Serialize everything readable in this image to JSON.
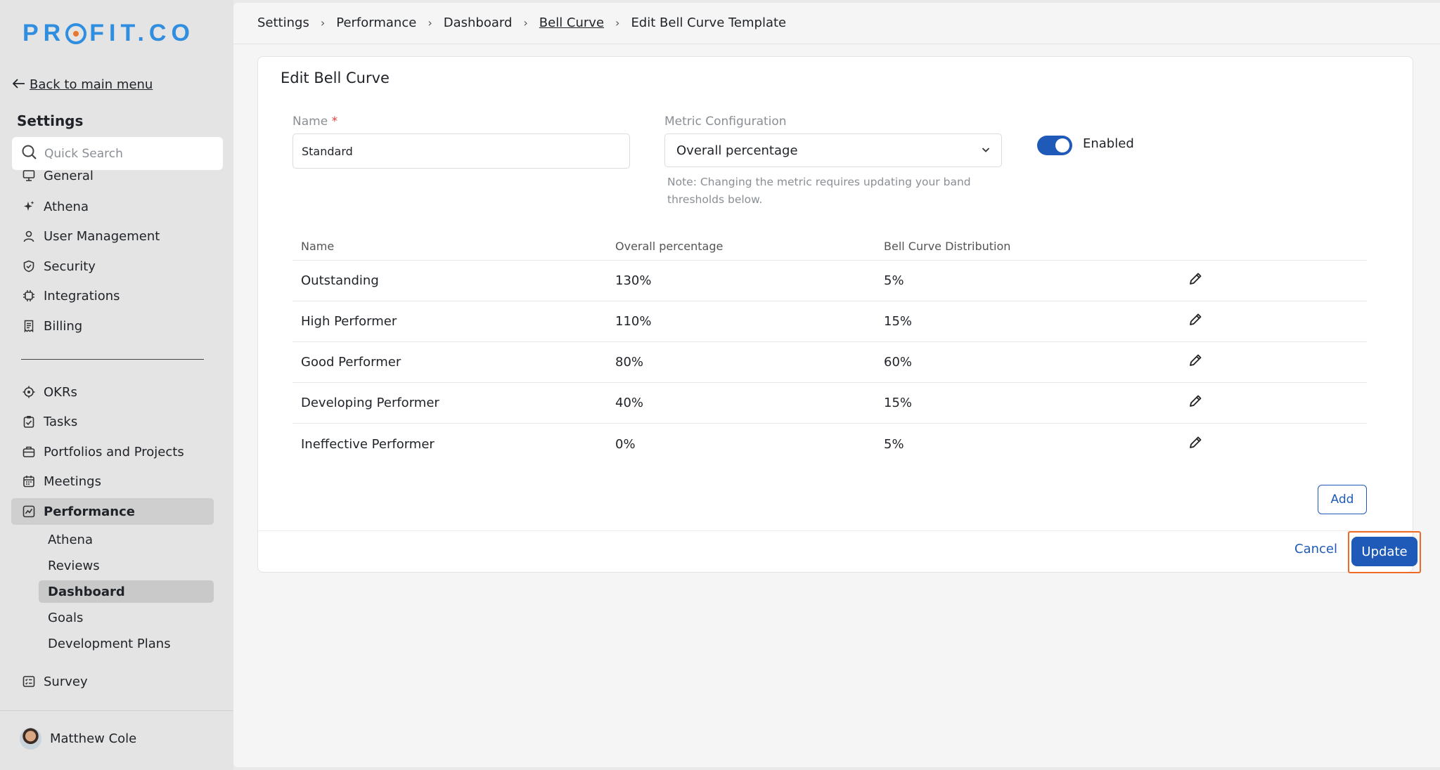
{
  "brand": {
    "logo_left": "PR",
    "logo_right": "FIT.CO",
    "primary_color": "#2f8ee0",
    "accent_color": "#1f5ab9"
  },
  "sidebar": {
    "back_label": "Back to main menu",
    "title": "Settings",
    "search_placeholder": "Quick Search",
    "settings_items": [
      {
        "label": "General",
        "icon": "monitor-icon"
      },
      {
        "label": "Athena",
        "icon": "sparkle-icon"
      },
      {
        "label": "User Management",
        "icon": "user-icon"
      },
      {
        "label": "Security",
        "icon": "shield-icon"
      },
      {
        "label": "Integrations",
        "icon": "chip-icon"
      },
      {
        "label": "Billing",
        "icon": "receipt-icon"
      }
    ],
    "app_items": [
      {
        "label": "OKRs",
        "icon": "target-icon"
      },
      {
        "label": "Tasks",
        "icon": "clipboard-icon"
      },
      {
        "label": "Portfolios and Projects",
        "icon": "briefcase-icon"
      },
      {
        "label": "Meetings",
        "icon": "calendar-icon"
      },
      {
        "label": "Performance",
        "icon": "chart-icon",
        "active": true
      }
    ],
    "performance_sub": [
      "Athena",
      "Reviews",
      "Dashboard",
      "Goals",
      "Development Plans"
    ],
    "active_sub": "Dashboard",
    "survey_label": "Survey",
    "user_name": "Matthew Cole"
  },
  "breadcrumb": [
    "Settings",
    "Performance",
    "Dashboard",
    "Bell Curve",
    "Edit Bell Curve Template"
  ],
  "form": {
    "title": "Edit Bell Curve",
    "name_label": "Name",
    "required_mark": "*",
    "name_value": "Standard",
    "metric_label": "Metric Configuration",
    "metric_value": "Overall percentage",
    "metric_note": "Note: Changing the metric requires updating your band thresholds below.",
    "enabled_label": "Enabled",
    "enabled": true
  },
  "table": {
    "headers": [
      "Name",
      "Overall percentage",
      "Bell Curve Distribution"
    ],
    "rows": [
      {
        "name": "Outstanding",
        "percentage": "130%",
        "distribution": "5%"
      },
      {
        "name": "High Performer",
        "percentage": "110%",
        "distribution": "15%"
      },
      {
        "name": "Good Performer",
        "percentage": "80%",
        "distribution": "60%"
      },
      {
        "name": "Developing Performer",
        "percentage": "40%",
        "distribution": "15%"
      },
      {
        "name": "Ineffective Performer",
        "percentage": "0%",
        "distribution": "5%"
      }
    ]
  },
  "actions": {
    "add": "Add",
    "cancel": "Cancel",
    "update": "Update"
  }
}
